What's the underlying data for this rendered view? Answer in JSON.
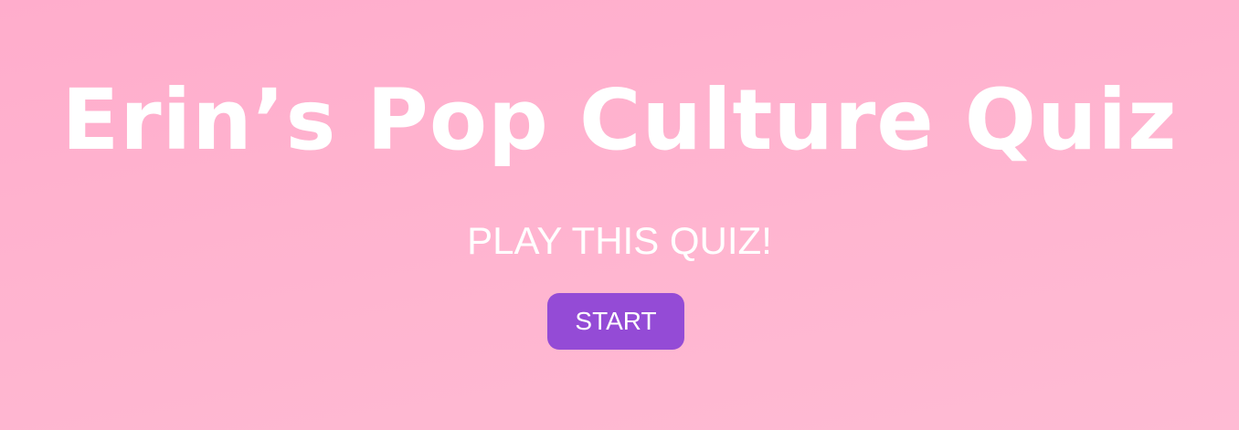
{
  "header": {
    "title": "Erin’s Pop Culture Quiz"
  },
  "main": {
    "subtitle": "PLAY THIS QUIZ!",
    "start_label": "START"
  },
  "colors": {
    "background": "#ffb3ce",
    "text": "#ffffff",
    "button": "#944bd6"
  }
}
